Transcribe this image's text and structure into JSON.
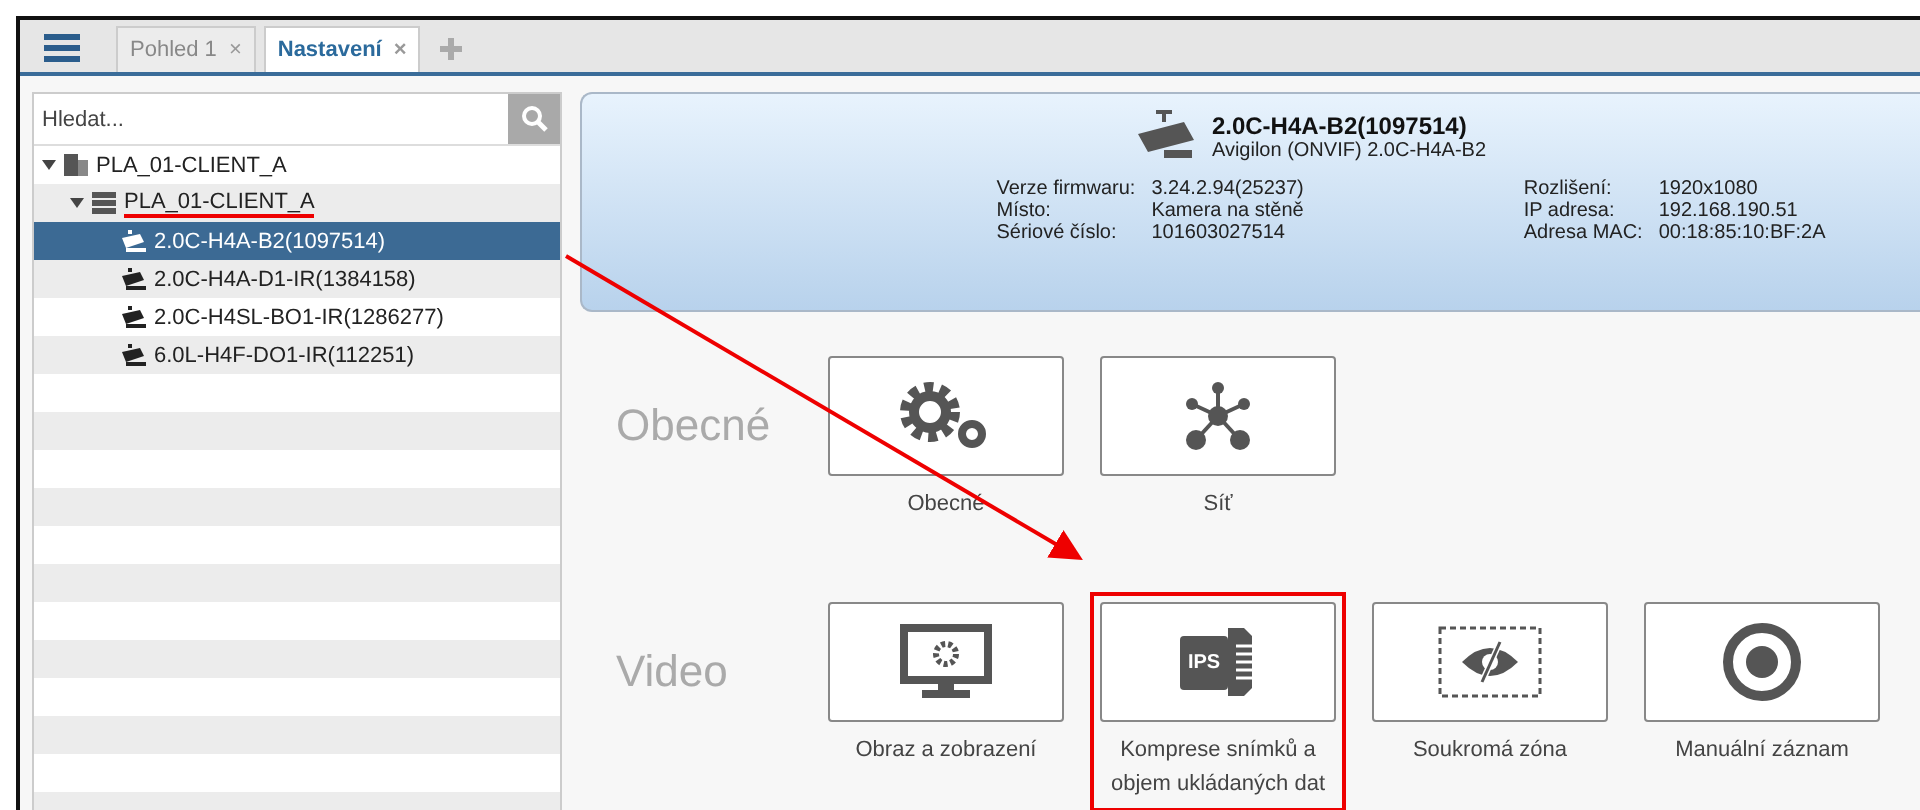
{
  "tabs": [
    {
      "label": "Pohled 1",
      "close": "×",
      "selected": false
    },
    {
      "label": "Nastavení",
      "close": "×",
      "selected": true
    }
  ],
  "search": {
    "placeholder": "Hledat..."
  },
  "tree": [
    {
      "label": "PLA_01-CLIENT_A",
      "kind": "site",
      "expanded": true,
      "selected": false,
      "underlined": false,
      "children": [
        {
          "label": "PLA_01-CLIENT_A",
          "kind": "server",
          "expanded": true,
          "selected": false,
          "underlined": true,
          "children": [
            {
              "label": "2.0C-H4A-B2(1097514)",
              "kind": "camera",
              "selected": true,
              "underlined": false
            },
            {
              "label": "2.0C-H4A-D1-IR(1384158)",
              "kind": "camera",
              "selected": false,
              "underlined": false
            },
            {
              "label": "2.0C-H4SL-BO1-IR(1286277)",
              "kind": "camera",
              "selected": false,
              "underlined": false
            },
            {
              "label": "6.0L-H4F-DO1-IR(112251)",
              "kind": "camera",
              "selected": false,
              "underlined": false
            }
          ]
        }
      ]
    }
  ],
  "device": {
    "name": "2.0C-H4A-B2(1097514)",
    "model": "Avigilon (ONVIF) 2.0C-H4A-B2",
    "info_left": [
      {
        "label": "Verze firmwaru:",
        "value": "3.24.2.94(25237)"
      },
      {
        "label": "Místo:",
        "value": "Kamera na stěně"
      },
      {
        "label": "Sériové číslo:",
        "value": "101603027514"
      }
    ],
    "info_right": [
      {
        "label": "Rozlišení:",
        "value": "1920x1080"
      },
      {
        "label": "IP adresa:",
        "value": "192.168.190.51"
      },
      {
        "label": "Adresa MAC:",
        "value": "00:18:85:10:BF:2A"
      }
    ]
  },
  "sections": [
    {
      "title": "Obecné",
      "tiles": [
        {
          "kind": "gears",
          "label": "Obecné"
        },
        {
          "kind": "network",
          "label": "Síť"
        }
      ]
    },
    {
      "title": "Video",
      "tiles": [
        {
          "kind": "monitor",
          "label": "Obraz a zobrazení"
        },
        {
          "kind": "storage",
          "label": "Komprese snímků a objem ukládaných dat",
          "icon_text": "IPS",
          "highlighted": true
        },
        {
          "kind": "privacy",
          "label": "Soukromá zóna"
        },
        {
          "kind": "record",
          "label": "Manuální záznam"
        }
      ]
    }
  ]
}
